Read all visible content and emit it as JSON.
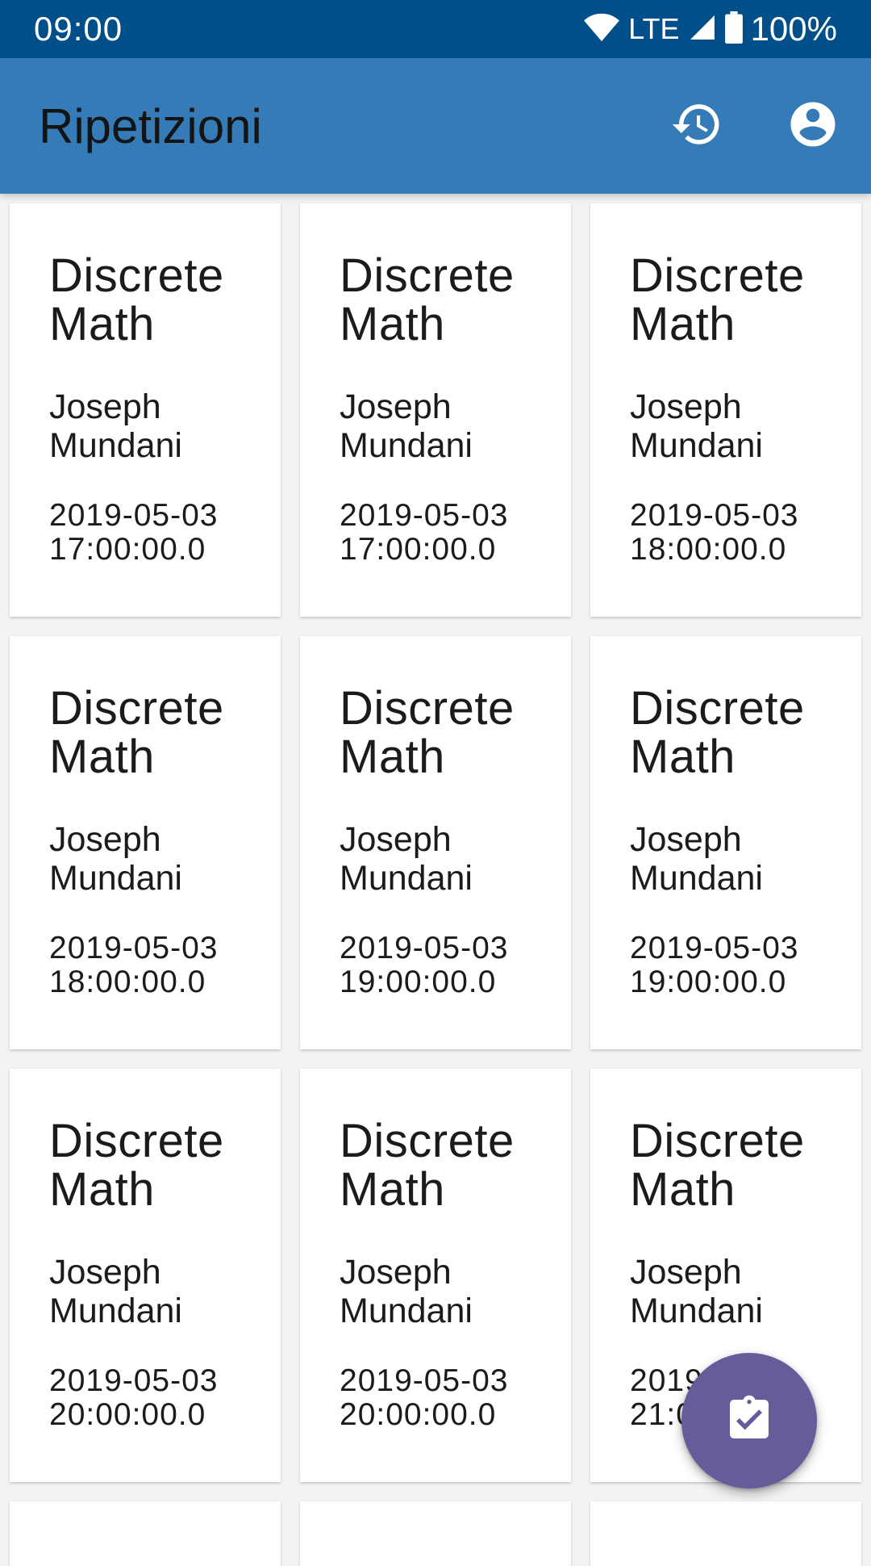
{
  "status_bar": {
    "time": "09:00",
    "network": "LTE",
    "battery": "100%",
    "icons": [
      "wifi-icon",
      "signal-icon",
      "battery-icon"
    ]
  },
  "app_bar": {
    "title": "Ripetizioni",
    "actions": [
      {
        "icon": "history-icon"
      },
      {
        "icon": "account-circle-icon"
      }
    ]
  },
  "cards": [
    {
      "course": "Discrete Math",
      "teacher": "Joseph Mundani",
      "datetime": "2019-05-03 17:00:00.0"
    },
    {
      "course": "Discrete Math",
      "teacher": "Joseph Mundani",
      "datetime": "2019-05-03 17:00:00.0"
    },
    {
      "course": "Discrete Math",
      "teacher": "Joseph Mundani",
      "datetime": "2019-05-03 18:00:00.0"
    },
    {
      "course": "Discrete Math",
      "teacher": "Joseph Mundani",
      "datetime": "2019-05-03 18:00:00.0"
    },
    {
      "course": "Discrete Math",
      "teacher": "Joseph Mundani",
      "datetime": "2019-05-03 19:00:00.0"
    },
    {
      "course": "Discrete Math",
      "teacher": "Joseph Mundani",
      "datetime": "2019-05-03 19:00:00.0"
    },
    {
      "course": "Discrete Math",
      "teacher": "Joseph Mundani",
      "datetime": "2019-05-03 20:00:00.0"
    },
    {
      "course": "Discrete Math",
      "teacher": "Joseph Mundani",
      "datetime": "2019-05-03 20:00:00.0"
    },
    {
      "course": "Discrete Math",
      "teacher": "Joseph Mundani",
      "datetime": "2019-05-03 21:00:00.0"
    }
  ],
  "fab": {
    "icon": "assignment-turned-in-icon"
  },
  "colors": {
    "status_bar": "#004f8a",
    "app_bar": "#347bb7",
    "background": "#f3f3f3",
    "fab": "#675c99"
  }
}
